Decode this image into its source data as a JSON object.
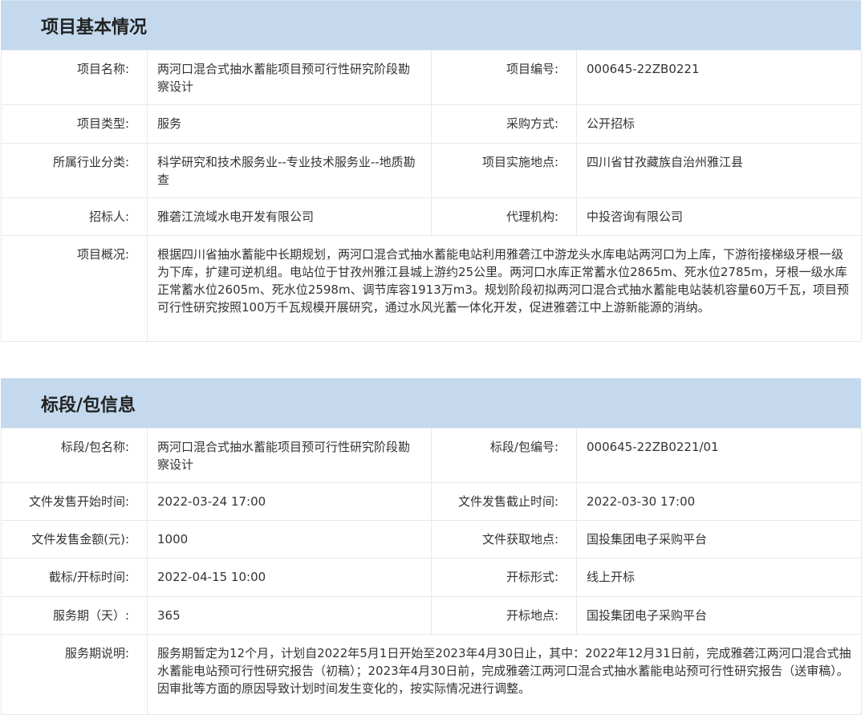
{
  "project_section": {
    "title": "项目基本情况",
    "rows": [
      {
        "l1": "项目名称:",
        "v1": "两河口混合式抽水蓄能项目预可行性研究阶段勘察设计",
        "l2": "项目编号:",
        "v2": "000645-22ZB0221"
      },
      {
        "l1": "项目类型:",
        "v1": "服务",
        "l2": "采购方式:",
        "v2": "公开招标"
      },
      {
        "l1": "所属行业分类:",
        "v1": "科学研究和技术服务业--专业技术服务业--地质勘查",
        "l2": "项目实施地点:",
        "v2": "四川省甘孜藏族自治州雅江县"
      },
      {
        "l1": "招标人:",
        "v1": "雅砻江流域水电开发有限公司",
        "l2": "代理机构:",
        "v2": "中投咨询有限公司"
      }
    ],
    "overview_label": "项目概况:",
    "overview_text": "根据四川省抽水蓄能中长期规划，两河口混合式抽水蓄能电站利用雅砻江中游龙头水库电站两河口为上库，下游衔接梯级牙根一级为下库，扩建可逆机组。电站位于甘孜州雅江县城上游约25公里。两河口水库正常蓄水位2865m、死水位2785m，牙根一级水库正常蓄水位2605m、死水位2598m、调节库容1913万m3。规划阶段初拟两河口混合式抽水蓄能电站装机容量60万千瓦，项目预可行性研究按照100万千瓦规模开展研究，通过水风光蓄一体化开发，促进雅砻江中上游新能源的消纳。"
  },
  "section_section": {
    "title": "标段/包信息",
    "rows": [
      {
        "l1": "标段/包名称:",
        "v1": "两河口混合式抽水蓄能项目预可行性研究阶段勘察设计",
        "l2": "标段/包编号:",
        "v2": "000645-22ZB0221/01"
      },
      {
        "l1": "文件发售开始时间:",
        "v1": "2022-03-24 17:00",
        "l2": "文件发售截止时间:",
        "v2": "2022-03-30 17:00"
      },
      {
        "l1": "文件发售金额(元):",
        "v1": "1000",
        "l2": "文件获取地点:",
        "v2": "国投集团电子采购平台"
      },
      {
        "l1": "截标/开标时间:",
        "v1": "2022-04-15 10:00",
        "l2": "开标形式:",
        "v2": "线上开标"
      },
      {
        "l1": "服务期（天）:",
        "v1": "365",
        "l2": "开标地点:",
        "v2": "国投集团电子采购平台"
      }
    ],
    "service_label": "服务期说明:",
    "service_text": "服务期暂定为12个月，计划自2022年5月1日开始至2023年4月30日止，其中：2022年12月31日前，完成雅砻江两河口混合式抽水蓄能电站预可行性研究报告（初稿）；2023年4月30日前，完成雅砻江两河口混合式抽水蓄能电站预可行性研究报告（送审稿）。 因审批等方面的原因导致计划时间发生变化的，按实际情况进行调整。"
  }
}
